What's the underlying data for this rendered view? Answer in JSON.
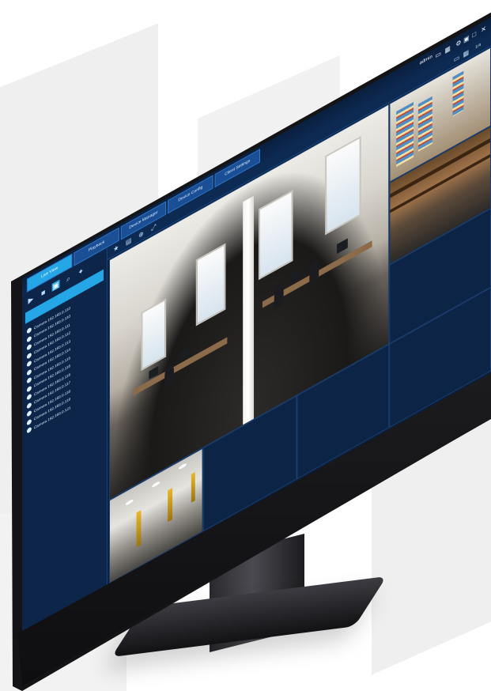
{
  "app": {
    "tabs": [
      {
        "label": "Live View"
      },
      {
        "label": "Playback"
      },
      {
        "label": "Device Manager"
      },
      {
        "label": "Device Config"
      },
      {
        "label": "Client Settings"
      }
    ],
    "user": "admin",
    "page_indicator": "1/4"
  },
  "sidebar": {
    "cameras": [
      {
        "label": "Camera 192.168.0.110"
      },
      {
        "label": "Camera 192.168.0.110"
      },
      {
        "label": "Camera 192.168.0.111"
      },
      {
        "label": "Camera 192.168.0.112"
      },
      {
        "label": "Camera 192.168.0.113"
      },
      {
        "label": "Camera 192.168.0.114"
      },
      {
        "label": "Camera 192.168.0.115"
      },
      {
        "label": "Camera 192.168.0.116"
      },
      {
        "label": "Camera 192.168.0.116"
      },
      {
        "label": "Camera 192.168.0.117"
      },
      {
        "label": "Camera 192.168.0.118"
      },
      {
        "label": "Camera 192.168.0.119"
      },
      {
        "label": "Camera 192.168.0.121"
      }
    ]
  },
  "icons": {
    "topbar": [
      "layout-icon",
      "grid-icon",
      "settings-icon",
      "lock-icon",
      "minimize-icon",
      "maximize-icon",
      "close-icon"
    ],
    "sidebar_tools": [
      "play-icon",
      "stop-icon",
      "camera-icon",
      "search-icon",
      "star-icon"
    ],
    "main_toolbar": [
      "star-icon",
      "image-icon",
      "target-icon",
      "fullscreen-icon"
    ]
  },
  "colors": {
    "accent": "#25a6e6",
    "background": "#0f2a52",
    "sidebar": "#0c2549"
  }
}
